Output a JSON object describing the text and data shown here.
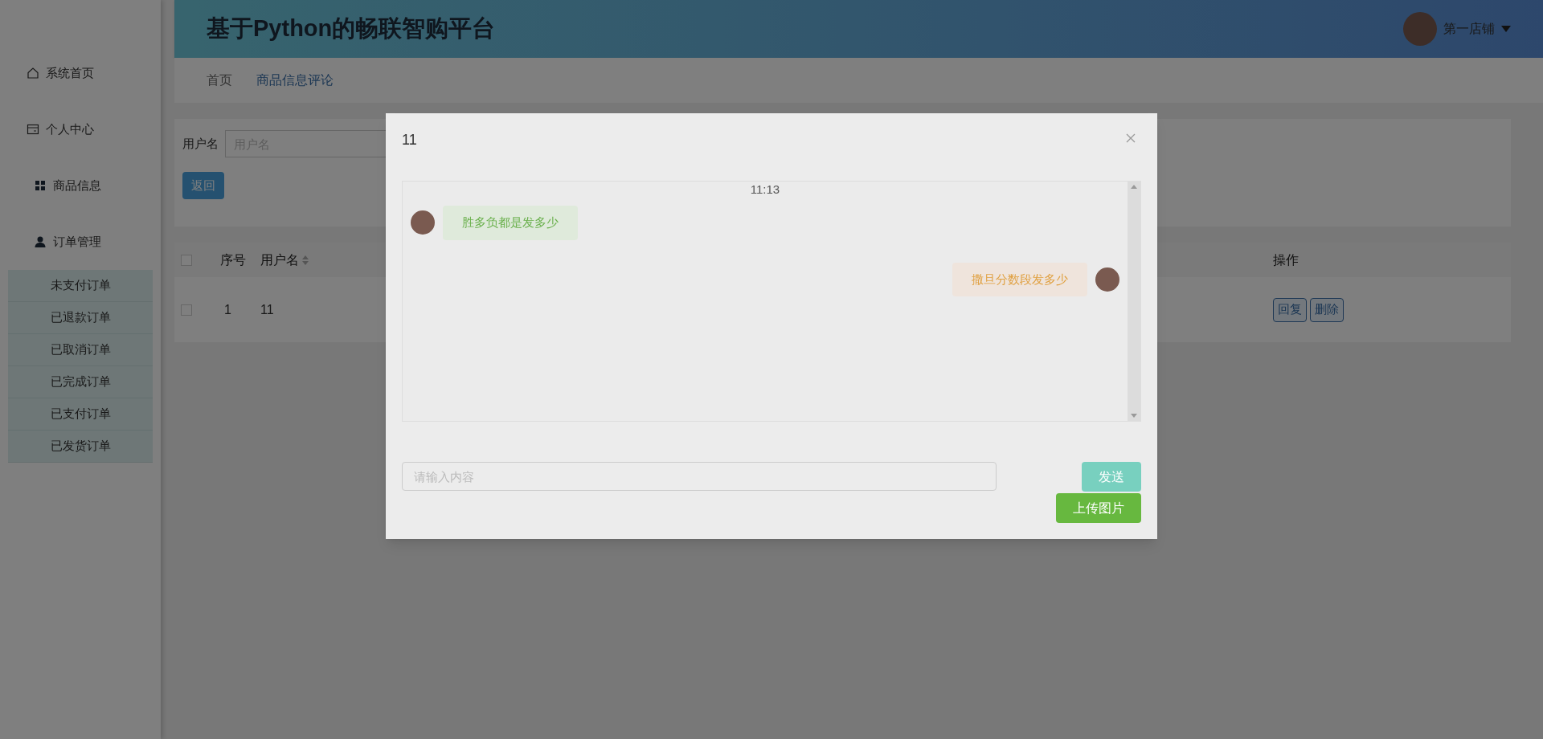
{
  "header": {
    "title": "基于Python的畅联智购平台",
    "user": "第一店铺"
  },
  "sidebar": {
    "items": [
      {
        "label": "系统首页",
        "kind": "home"
      },
      {
        "label": "个人中心",
        "kind": "card"
      },
      {
        "label": "商品信息",
        "kind": "grid"
      },
      {
        "label": "订单管理",
        "kind": "user",
        "children": [
          {
            "label": "未支付订单"
          },
          {
            "label": "已退款订单"
          },
          {
            "label": "已取消订单"
          },
          {
            "label": "已完成订单"
          },
          {
            "label": "已支付订单"
          },
          {
            "label": "已发货订单"
          }
        ]
      }
    ]
  },
  "breadcrumb": [
    {
      "label": "首页",
      "selected": false
    },
    {
      "label": "商品信息评论",
      "selected": true
    }
  ],
  "search": {
    "label": "用户名",
    "placeholder": "用户名",
    "back_button": "返回"
  },
  "table": {
    "all_checked": false,
    "columns": [
      {
        "label": "序号",
        "sortable": false
      },
      {
        "label": "用户名",
        "sortable": true
      },
      {
        "label": "操作",
        "sortable": false
      }
    ],
    "rows": [
      {
        "checked": false,
        "cells": [
          "1",
          "11"
        ],
        "actions": [
          "回复",
          "删除"
        ]
      }
    ]
  },
  "dialog": {
    "title": "11",
    "messages": [
      {
        "kind": "time",
        "text": "11:13"
      },
      {
        "kind": "received",
        "text": "胜多负都是发多少"
      },
      {
        "kind": "sent",
        "text": "撒旦分数段发多少"
      }
    ],
    "placeholder": "请输入内容",
    "send_button": "发送",
    "upload_button": "上传图片"
  }
}
